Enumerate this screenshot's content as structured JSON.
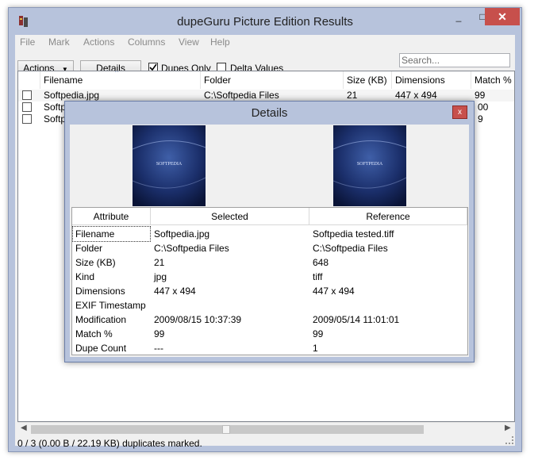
{
  "window": {
    "title": "dupeGuru Picture Edition Results",
    "minimize": "_",
    "maximize": "□",
    "close": "✕"
  },
  "menu": [
    "File",
    "Mark",
    "Actions",
    "Columns",
    "View",
    "Help"
  ],
  "toolbar": {
    "actions_label": "Actions",
    "details_label": "Details",
    "dupes_only_label": "Dupes Only",
    "dupes_only_checked": true,
    "delta_values_label": "Delta Values",
    "delta_values_checked": false,
    "search_placeholder": "Search..."
  },
  "table": {
    "columns": [
      "Filename",
      "Folder",
      "Size (KB)",
      "Dimensions",
      "Match %"
    ],
    "rows": [
      {
        "filename": "Softpedia.jpg",
        "folder": "C:\\Softpedia Files",
        "size": "21",
        "dimensions": "447 x 494",
        "match": "99"
      },
      {
        "filename": "Softp",
        "folder": "",
        "size": "",
        "dimensions": "",
        "match": "00"
      },
      {
        "filename": "Softp",
        "folder": "",
        "size": "",
        "dimensions": "",
        "match": "9"
      }
    ]
  },
  "status": "0 / 3 (0.00 B / 22.19 KB) duplicates marked.",
  "details": {
    "title": "Details",
    "close": "x",
    "columns": [
      "Attribute",
      "Selected",
      "Reference"
    ],
    "rows": [
      {
        "attribute": "Filename",
        "selected": "Softpedia.jpg",
        "reference": "Softpedia tested.tiff"
      },
      {
        "attribute": "Folder",
        "selected": "C:\\Softpedia Files",
        "reference": "C:\\Softpedia Files"
      },
      {
        "attribute": "Size (KB)",
        "selected": "21",
        "reference": "648"
      },
      {
        "attribute": "Kind",
        "selected": "jpg",
        "reference": "tiff"
      },
      {
        "attribute": "Dimensions",
        "selected": "447 x 494",
        "reference": "447 x 494"
      },
      {
        "attribute": "EXIF Timestamp",
        "selected": "",
        "reference": ""
      },
      {
        "attribute": "Modification",
        "selected": "2009/08/15 10:37:39",
        "reference": "2009/05/14 11:01:01"
      },
      {
        "attribute": "Match %",
        "selected": "99",
        "reference": "99"
      },
      {
        "attribute": "Dupe Count",
        "selected": "---",
        "reference": "1"
      }
    ],
    "thumbnail_text": "SOFTPEDIA"
  },
  "colors": {
    "window_frame": "#b7c3dc",
    "close_red": "#c7504c",
    "thumb_blue": "#1b2f6b"
  }
}
